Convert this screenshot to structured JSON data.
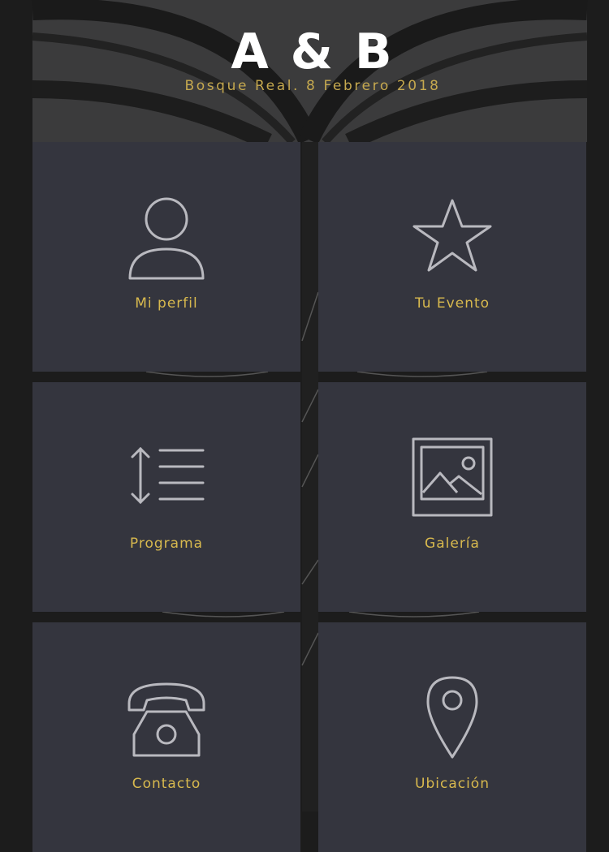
{
  "header": {
    "title": "A & B",
    "subtitle": "Bosque Real. 8 Febrero 2018"
  },
  "menu": {
    "items": [
      {
        "label": "Mi perfil",
        "icon": "user-icon"
      },
      {
        "label": "Tu Evento",
        "icon": "star-icon"
      },
      {
        "label": "Programa",
        "icon": "schedule-list-icon"
      },
      {
        "label": "Galería",
        "icon": "gallery-image-icon"
      },
      {
        "label": "Contacto",
        "icon": "phone-icon"
      },
      {
        "label": "Ubicación",
        "icon": "location-pin-icon"
      }
    ]
  },
  "colors": {
    "background": "#1c1c1c",
    "tile": "#34353e",
    "label": "#d8b94e",
    "subtitle": "#c6a94f",
    "icon_stroke": "#b9b9bf"
  }
}
